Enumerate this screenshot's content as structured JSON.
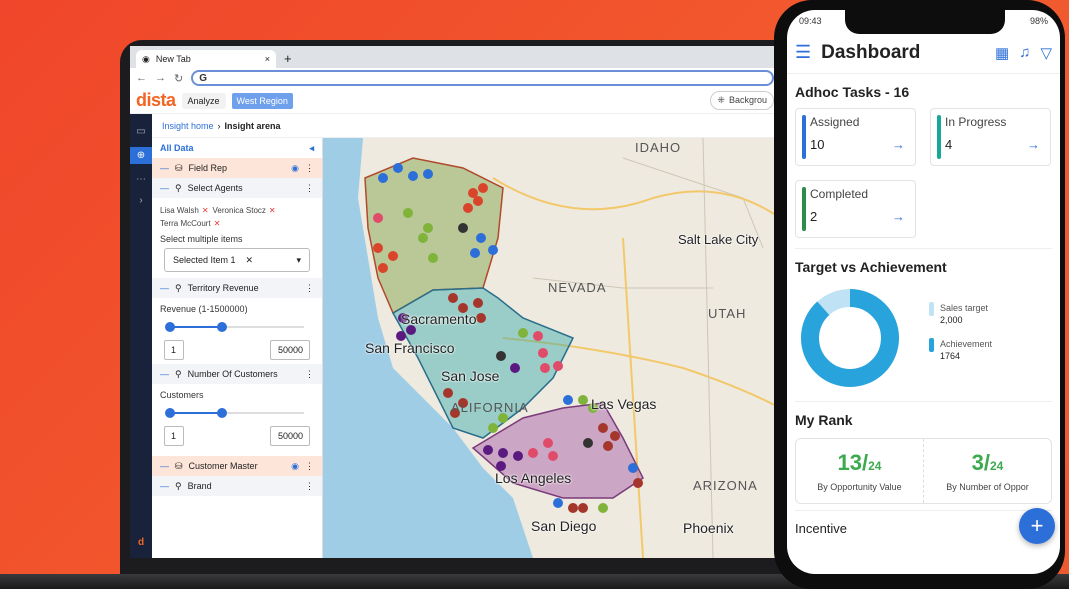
{
  "browser": {
    "tab_title": "New Tab",
    "tab_close": "×",
    "new_tab": "+",
    "url": "G"
  },
  "app": {
    "logo": "dista",
    "analyze_label": "Analyze",
    "region_label": "West Region",
    "background_label": "Backgrou",
    "breadcrumb": {
      "home": "Insight home",
      "sep": "›",
      "current": "Insight arena"
    }
  },
  "panel": {
    "all_data": "All Data",
    "field_rep": "Field Rep",
    "select_agents": "Select Agents",
    "agents": [
      "Lisa Walsh",
      "Veronica Stocz",
      "Terra McCourt"
    ],
    "select_multiple": "Select multiple items",
    "selected_item": "Selected Item 1",
    "territory_revenue": "Territory Revenue",
    "revenue_label": "Revenue (1-1500000)",
    "revenue_min": "1",
    "revenue_max": "50000",
    "number_of_customers": "Number Of Customers",
    "customers_label": "Customers",
    "customers_min": "1",
    "customers_max": "50000",
    "customer_master": "Customer Master",
    "brand": "Brand"
  },
  "map": {
    "labels": [
      "IDAHO",
      "NEVADA",
      "UTAH",
      "ARIZONA",
      "ALIFORNIA"
    ],
    "cities": [
      "Salt Lake City",
      "Sacramento",
      "San Francisco",
      "San Jose",
      "Las Vegas",
      "Los Angeles",
      "San Diego",
      "Phoenix"
    ]
  },
  "phone": {
    "time": "09:43",
    "battery": "98%",
    "title": "Dashboard",
    "adhoc_title": "Adhoc Tasks - 16",
    "tasks": [
      {
        "label": "Assigned",
        "value": "10",
        "color": "#2d6fd8"
      },
      {
        "label": "In Progress",
        "value": "4",
        "color": "#17a89a"
      },
      {
        "label": "Completed",
        "value": "2",
        "color": "#2e8b4a"
      }
    ],
    "target_title": "Target vs Achievement",
    "sales_target_label": "Sales target",
    "sales_target_value": "2,000",
    "achievement_label": "Achievement",
    "achievement_value": "1764",
    "achievement_fraction": 0.882,
    "rank_title": "My Rank",
    "rank_opp_value": "13/",
    "rank_opp_total": "24",
    "rank_opp_caption": "By Opportunity Value",
    "rank_num_value": "3/",
    "rank_num_total": "24",
    "rank_num_caption": "By Number of Oppor",
    "incentive_title": "Incentive",
    "fab": "+"
  }
}
